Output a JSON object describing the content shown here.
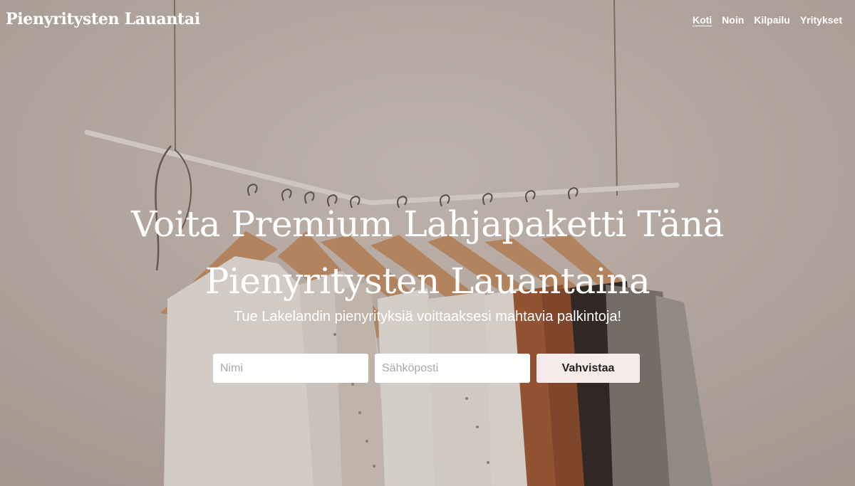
{
  "brand": {
    "title": "Pienyritysten Lauantai"
  },
  "nav": {
    "items": [
      {
        "label": "Koti",
        "active": true
      },
      {
        "label": "Noin",
        "active": false
      },
      {
        "label": "Kilpailu",
        "active": false
      },
      {
        "label": "Yritykset",
        "active": false
      }
    ]
  },
  "hero": {
    "headline_line1": "Voita Premium Lahjapaketti Tänä",
    "headline_line2": "Pienyritysten Lauantaina",
    "subline": "Tue Lakelandin pienyrityksiä voittaaksesi mahtavia palkintoja!"
  },
  "form": {
    "name_placeholder": "Nimi",
    "email_placeholder": "Sähköposti",
    "submit_label": "Vahvistaa"
  },
  "colors": {
    "wall": "#c8bdb4",
    "button_bg": "#f7eceb",
    "text": "#ffffff"
  },
  "background_image": {
    "icon": "clothing-rack-photo"
  }
}
